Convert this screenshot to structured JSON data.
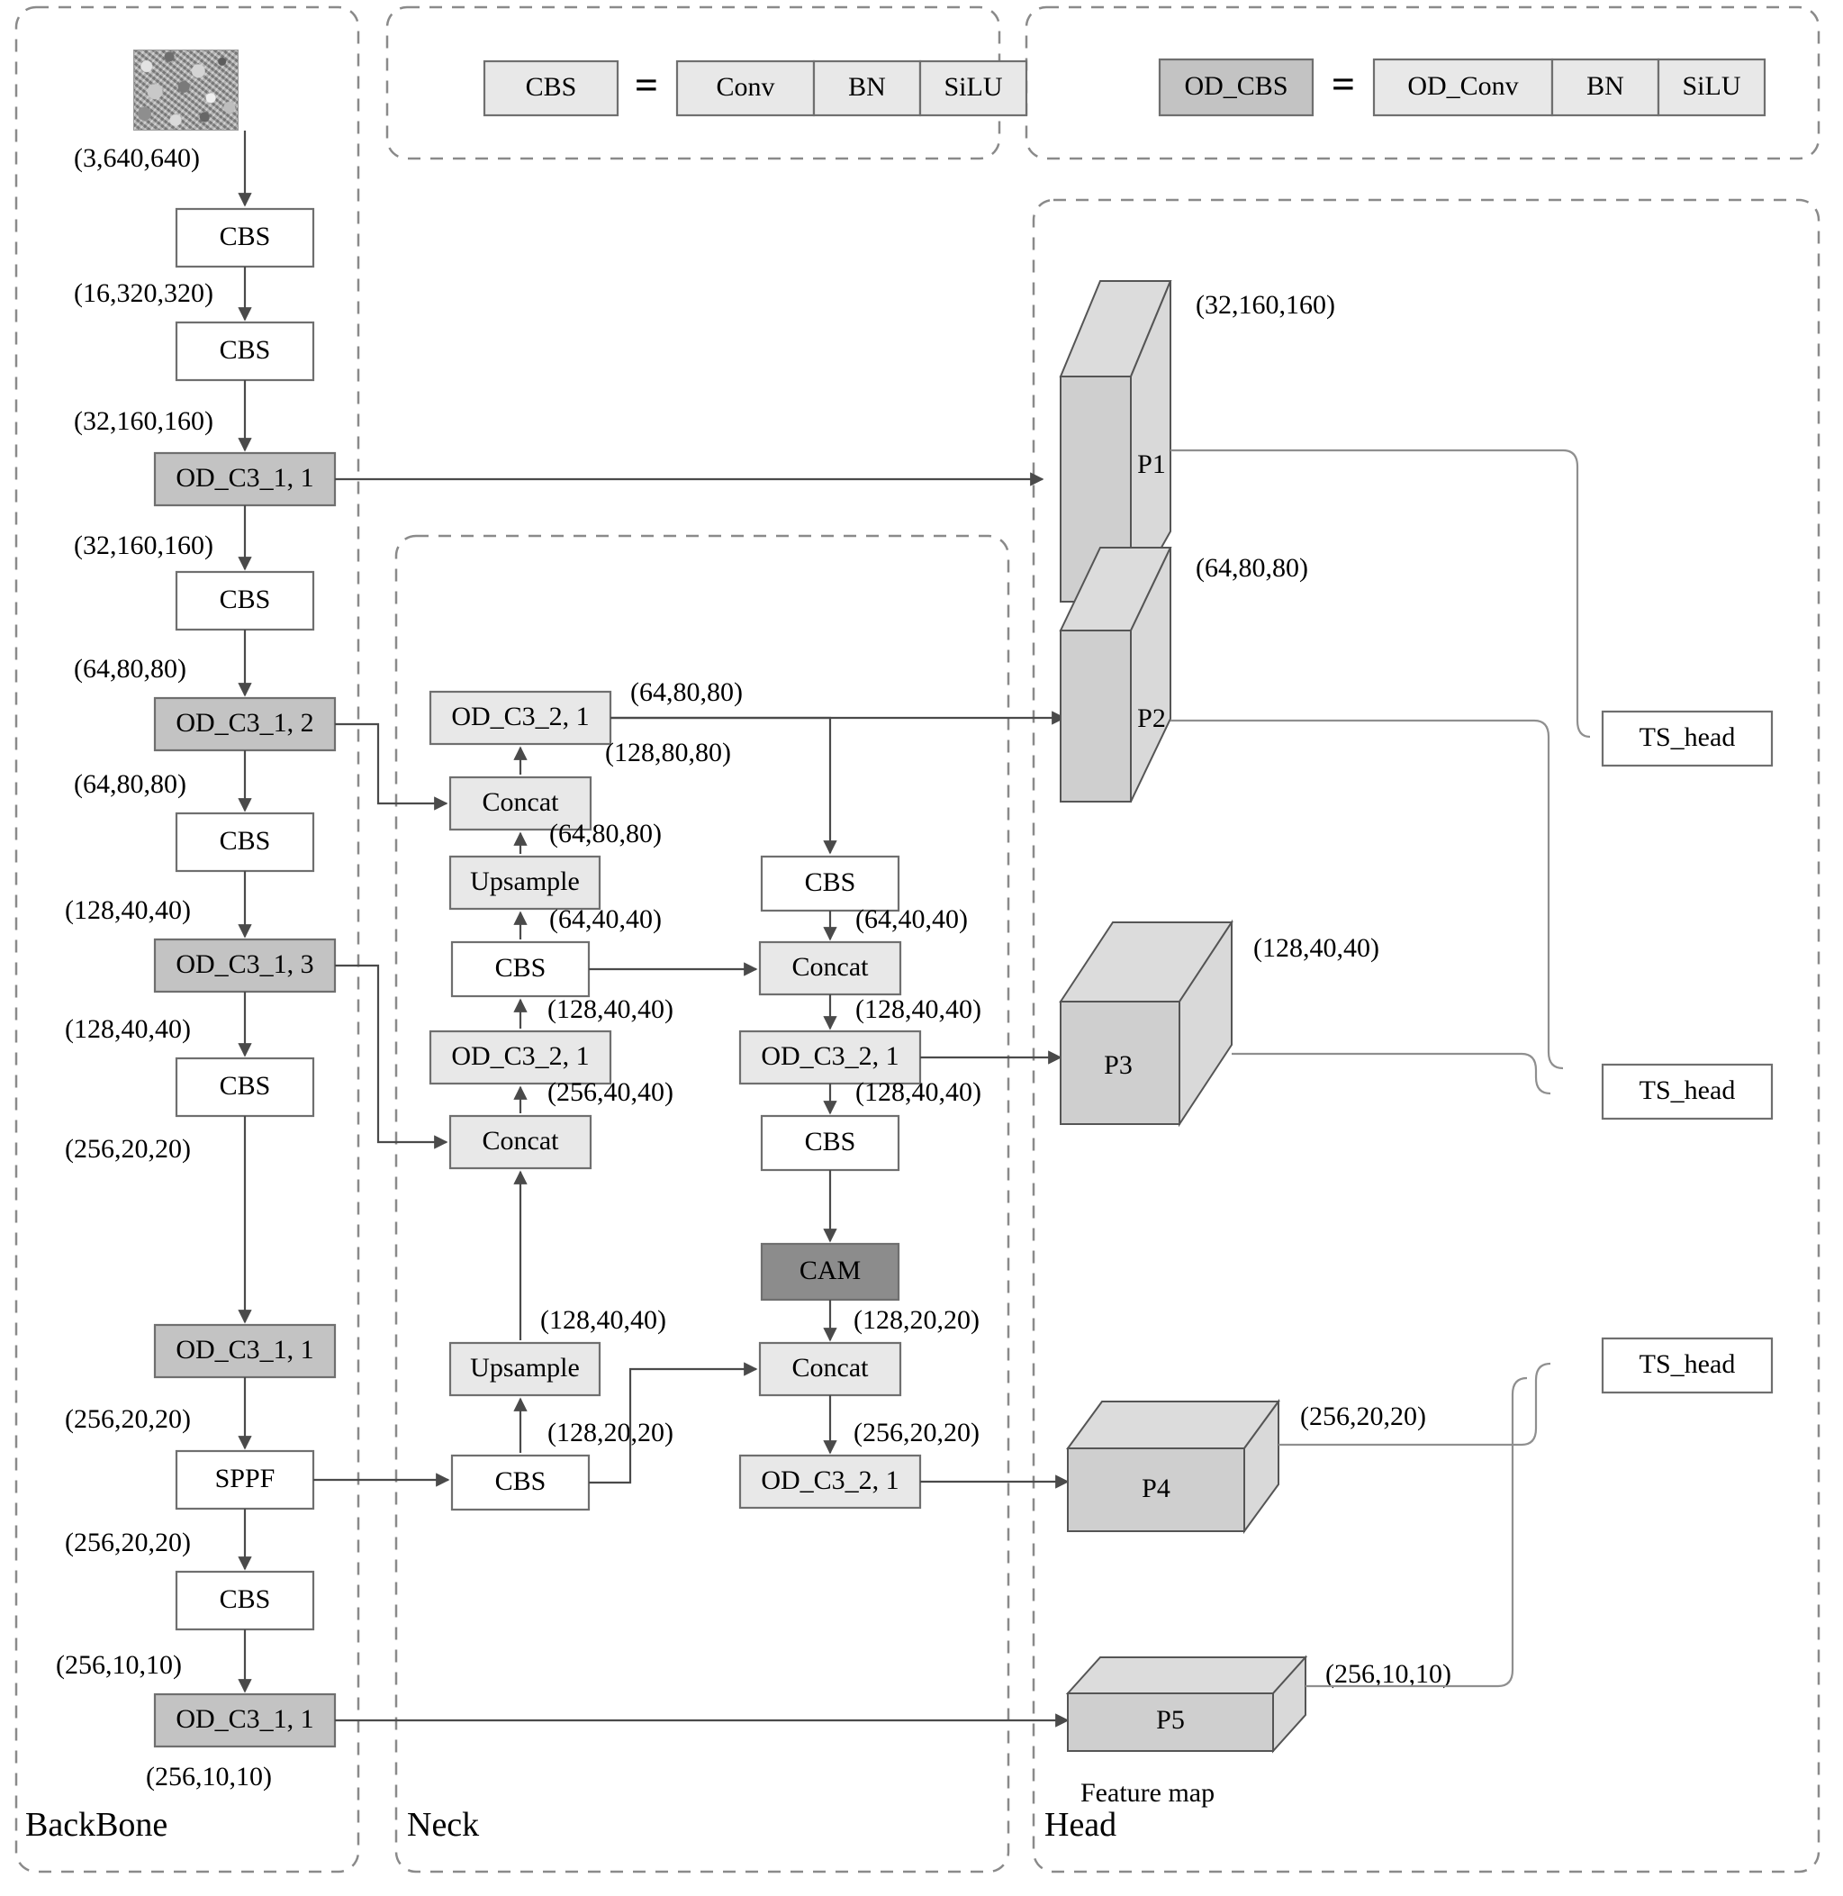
{
  "sections": {
    "backbone": "BackBone",
    "neck": "Neck",
    "head": "Head"
  },
  "legend": {
    "cbs": {
      "name": "CBS",
      "equals": "=",
      "parts": [
        "Conv",
        "BN",
        "SiLU"
      ]
    },
    "od_cbs": {
      "name": "OD_CBS",
      "equals": "=",
      "parts": [
        "OD_Conv",
        "BN",
        "SiLU"
      ]
    }
  },
  "backbone": {
    "input_image_alt": "input-texture-image",
    "nodes": [
      {
        "id": "bb_cbs1",
        "label": "CBS",
        "style": "white"
      },
      {
        "id": "bb_cbs2",
        "label": "CBS",
        "style": "white"
      },
      {
        "id": "bb_odc3_1",
        "label": "OD_C3_1, 1",
        "style": "mid"
      },
      {
        "id": "bb_cbs3",
        "label": "CBS",
        "style": "white"
      },
      {
        "id": "bb_odc3_2",
        "label": "OD_C3_1, 2",
        "style": "mid"
      },
      {
        "id": "bb_cbs4",
        "label": "CBS",
        "style": "white"
      },
      {
        "id": "bb_odc3_3",
        "label": "OD_C3_1, 3",
        "style": "mid"
      },
      {
        "id": "bb_cbs5",
        "label": "CBS",
        "style": "white"
      },
      {
        "id": "bb_odc3_4",
        "label": "OD_C3_1, 1",
        "style": "mid"
      },
      {
        "id": "bb_sppf",
        "label": "SPPF",
        "style": "white"
      },
      {
        "id": "bb_cbs6",
        "label": "CBS",
        "style": "white"
      },
      {
        "id": "bb_odc3_5",
        "label": "OD_C3_1, 1",
        "style": "mid"
      }
    ],
    "dims": [
      "(3,640,640)",
      "(16,320,320)",
      "(32,160,160)",
      "(32,160,160)",
      "(64,80,80)",
      "(64,80,80)",
      "(128,40,40)",
      "(128,40,40)",
      "(256,20,20)",
      "(256,20,20)",
      "(256,20,20)",
      "(256,10,10)",
      "(256,10,10)"
    ]
  },
  "neck": {
    "left_column": [
      {
        "id": "nk_odc3_2_top",
        "label": "OD_C3_2, 1",
        "style": "light"
      },
      {
        "id": "nk_concat_top",
        "label": "Concat",
        "style": "light"
      },
      {
        "id": "nk_upsample_top",
        "label": "Upsample",
        "style": "light"
      },
      {
        "id": "nk_cbs_mid",
        "label": "CBS",
        "style": "white"
      },
      {
        "id": "nk_odc3_2_mid",
        "label": "OD_C3_2, 1",
        "style": "light"
      },
      {
        "id": "nk_concat_mid",
        "label": "Concat",
        "style": "light"
      },
      {
        "id": "nk_upsample_bot",
        "label": "Upsample",
        "style": "light"
      },
      {
        "id": "nk_cbs_bot",
        "label": "CBS",
        "style": "white"
      }
    ],
    "right_column": [
      {
        "id": "nk_cbs_r1",
        "label": "CBS",
        "style": "white"
      },
      {
        "id": "nk_concat_r1",
        "label": "Concat",
        "style": "light"
      },
      {
        "id": "nk_odc3_2_r1",
        "label": "OD_C3_2, 1",
        "style": "light"
      },
      {
        "id": "nk_cbs_r2",
        "label": "CBS",
        "style": "white"
      },
      {
        "id": "nk_cam",
        "label": "CAM",
        "style": "dark"
      },
      {
        "id": "nk_concat_r2",
        "label": "Concat",
        "style": "light"
      },
      {
        "id": "nk_odc3_2_r2",
        "label": "OD_C3_2, 1",
        "style": "light"
      }
    ],
    "dims": {
      "odc3_2_top_out": "(64,80,80)",
      "concat_top_out": "(128,80,80)",
      "upsample_top_out": "(64,80,80)",
      "cbs_mid_out": "(64,40,40)",
      "odc3_2_mid_out": "(128,40,40)",
      "concat_mid_out": "(256,40,40)",
      "upsample_bot_out": "(128,40,40)",
      "cbs_bot_out": "(128,20,20)",
      "cbs_r1_out": "(64,40,40)",
      "concat_r1_out": "(128,40,40)",
      "odc3_2_r1_out": "(128,40,40)",
      "cam_out": "(128,20,20)",
      "concat_r2_out": "(256,20,20)"
    }
  },
  "head": {
    "feature_maps": [
      {
        "id": "p1",
        "label": "P1",
        "dim": "(32,160,160)"
      },
      {
        "id": "p2",
        "label": "P2",
        "dim": "(64,80,80)"
      },
      {
        "id": "p3",
        "label": "P3",
        "dim": "(128,40,40)"
      },
      {
        "id": "p4",
        "label": "P4",
        "dim": "(256,20,20)"
      },
      {
        "id": "p5",
        "label": "P5",
        "dim": "(256,10,10)"
      }
    ],
    "caption": "Feature map",
    "ts_heads": [
      {
        "id": "ts1",
        "label": "TS_head"
      },
      {
        "id": "ts2",
        "label": "TS_head"
      },
      {
        "id": "ts3",
        "label": "TS_head"
      }
    ]
  }
}
